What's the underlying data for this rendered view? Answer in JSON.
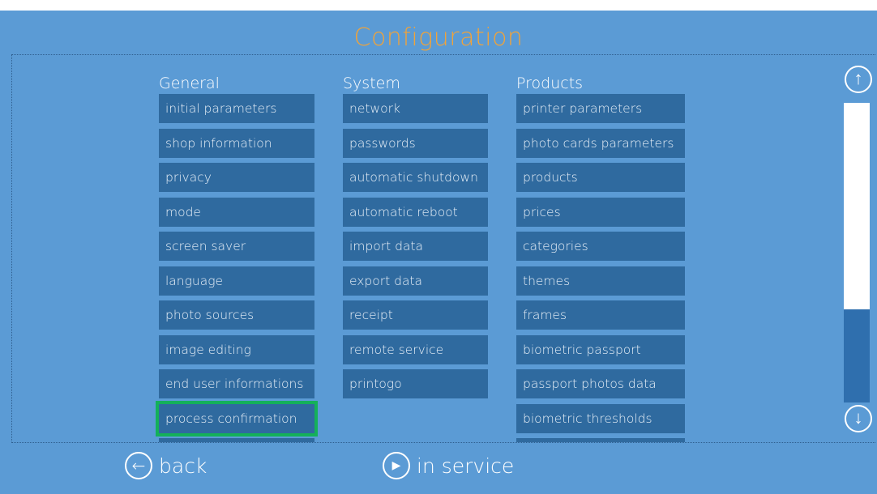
{
  "title": "Configuration",
  "columns": [
    {
      "heading": "General",
      "items": [
        "initial parameters",
        "shop information",
        "privacy",
        "mode",
        "screen saver",
        "language",
        "photo sources",
        "image editing",
        "end user informations",
        "process confirmation"
      ],
      "selected_index": 9
    },
    {
      "heading": "System",
      "items": [
        "network",
        "passwords",
        "automatic shutdown",
        "automatic reboot",
        "import data",
        "export data",
        "receipt",
        "remote service",
        "printogo"
      ]
    },
    {
      "heading": "Products",
      "items": [
        "printer parameters",
        "photo cards parameters",
        "products",
        "prices",
        "categories",
        "themes",
        "frames",
        "biometric passport",
        "passport photos data",
        "biometric thresholds"
      ]
    }
  ],
  "footer": {
    "back_label": "back",
    "in_service_label": "in service"
  },
  "scrollbar": {
    "thumb_fraction": 0.31
  },
  "icons": {
    "scroll_up": "arrow-up-circle-icon",
    "scroll_down": "arrow-down-circle-icon",
    "back": "arrow-left-circle-icon",
    "in_service": "play-circle-icon"
  },
  "colors": {
    "background": "#5b9bd5",
    "button": "#2f6a9f",
    "title": "#f0a33a",
    "selected_outline": "#14b05a"
  }
}
